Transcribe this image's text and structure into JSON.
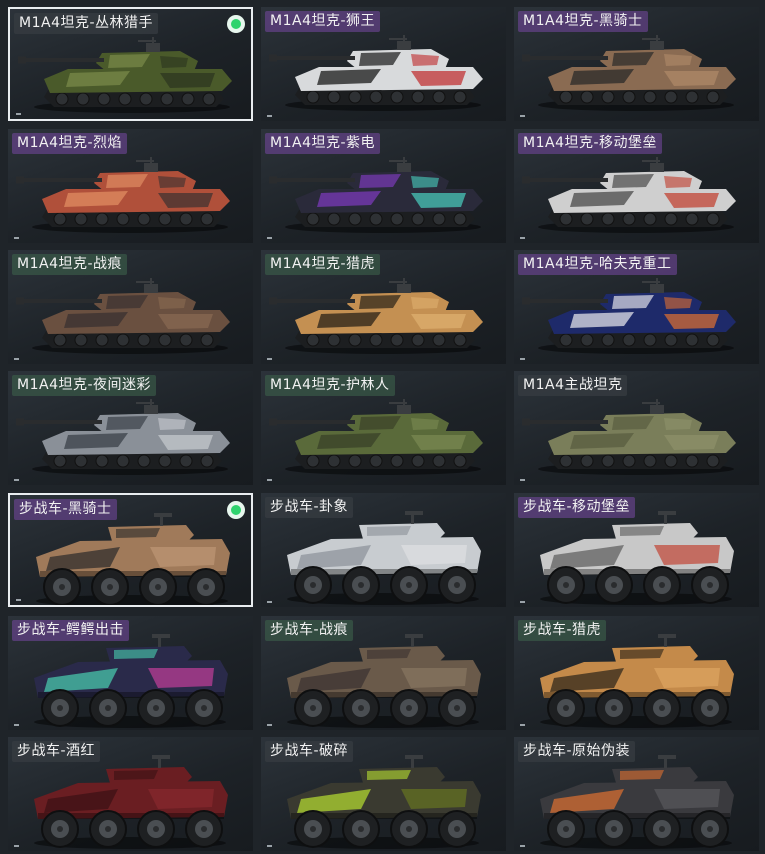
{
  "colors": {
    "label_purple": "#6e4696",
    "label_green": "#3c5f4b",
    "label_gray": "#373c42",
    "equipped_dot": "#2fd36e",
    "selected_border": "#e9edf0"
  },
  "skins": [
    {
      "name": "M1A4坦克-丛林猎手",
      "tag": "gray",
      "type": "tank",
      "selected": true,
      "equipped": true,
      "body": "#4a5a2a",
      "accent": "#7a8a4a",
      "detail": "#2b3320"
    },
    {
      "name": "M1A4坦克-狮王",
      "tag": "purple",
      "type": "tank",
      "selected": false,
      "equipped": false,
      "body": "#d8dadc",
      "accent": "#1a1a1a",
      "detail": "#c0282a"
    },
    {
      "name": "M1A4坦克-黑骑士",
      "tag": "purple",
      "type": "tank",
      "selected": false,
      "equipped": false,
      "body": "#8a6b52",
      "accent": "#2a2a2a",
      "detail": "#b08a6a"
    },
    {
      "name": "M1A4坦克-烈焰",
      "tag": "purple",
      "type": "tank",
      "selected": false,
      "equipped": false,
      "body": "#b0503a",
      "accent": "#e08c62",
      "detail": "#3a3030"
    },
    {
      "name": "M1A4坦克-紫电",
      "tag": "purple",
      "type": "tank",
      "selected": false,
      "equipped": false,
      "body": "#2a2a3a",
      "accent": "#7a3ab8",
      "detail": "#4ad0c0"
    },
    {
      "name": "M1A4坦克-移动堡垒",
      "tag": "purple",
      "type": "tank",
      "selected": false,
      "equipped": false,
      "body": "#cfcfcf",
      "accent": "#4a4a4a",
      "detail": "#c03a2a"
    },
    {
      "name": "M1A4坦克-战痕",
      "tag": "green",
      "type": "tank",
      "selected": false,
      "equipped": false,
      "body": "#6a5040",
      "accent": "#3a3030",
      "detail": "#8a6a52"
    },
    {
      "name": "M1A4坦克-猎虎",
      "tag": "green",
      "type": "tank",
      "selected": false,
      "equipped": false,
      "body": "#c49052",
      "accent": "#2a2218",
      "detail": "#e0b070"
    },
    {
      "name": "M1A4坦克-哈夫克重工",
      "tag": "purple",
      "type": "tank",
      "selected": false,
      "equipped": false,
      "body": "#1e2a6a",
      "accent": "#e0e0e8",
      "detail": "#e07030"
    },
    {
      "name": "M1A4坦克-夜间迷彩",
      "tag": "green",
      "type": "tank",
      "selected": false,
      "equipped": false,
      "body": "#8a9098",
      "accent": "#3a4048",
      "detail": "#c8ccd0"
    },
    {
      "name": "M1A4坦克-护林人",
      "tag": "green",
      "type": "tank",
      "selected": false,
      "equipped": false,
      "body": "#5a6a3a",
      "accent": "#3a4228",
      "detail": "#7a8a52"
    },
    {
      "name": "M1A4主战坦克",
      "tag": "gray",
      "type": "tank",
      "selected": false,
      "equipped": false,
      "body": "#7a7e5a",
      "accent": "#5a5e40",
      "detail": "#8e926a"
    },
    {
      "name": "步战车-黑骑士",
      "tag": "purple",
      "type": "ifv",
      "selected": true,
      "equipped": true,
      "body": "#a07a5a",
      "accent": "#2a2a2a",
      "detail": "#c09a78"
    },
    {
      "name": "步战车-卦象",
      "tag": "gray",
      "type": "ifv",
      "selected": false,
      "equipped": false,
      "body": "#c8ccd0",
      "accent": "#8a9098",
      "detail": "#e0e2e4"
    },
    {
      "name": "步战车-移动堡垒",
      "tag": "purple",
      "type": "ifv",
      "selected": false,
      "equipped": false,
      "body": "#c8c8c8",
      "accent": "#5a5a5a",
      "detail": "#c03a2a"
    },
    {
      "name": "步战车-鳄鳄出击",
      "tag": "purple",
      "type": "ifv",
      "selected": false,
      "equipped": false,
      "body": "#2a2a4a",
      "accent": "#4ad0b0",
      "detail": "#d040a0"
    },
    {
      "name": "步战车-战痕",
      "tag": "green",
      "type": "ifv",
      "selected": false,
      "equipped": false,
      "body": "#6a5a4a",
      "accent": "#3a3030",
      "detail": "#8a7a62"
    },
    {
      "name": "步战车-猎虎",
      "tag": "green",
      "type": "ifv",
      "selected": false,
      "equipped": false,
      "body": "#c48a4a",
      "accent": "#2a2218",
      "detail": "#e0a862"
    },
    {
      "name": "步战车-酒红",
      "tag": "gray",
      "type": "ifv",
      "selected": false,
      "equipped": false,
      "body": "#6a1e22",
      "accent": "#3a1014",
      "detail": "#8a2a30"
    },
    {
      "name": "步战车-破碎",
      "tag": "gray",
      "type": "ifv",
      "selected": false,
      "equipped": false,
      "body": "#3a3a30",
      "accent": "#b8e030",
      "detail": "#6a7a20"
    },
    {
      "name": "步战车-原始伪装",
      "tag": "gray",
      "type": "ifv",
      "selected": false,
      "equipped": false,
      "body": "#3a3a3e",
      "accent": "#e07030",
      "detail": "#5a5a60"
    }
  ]
}
